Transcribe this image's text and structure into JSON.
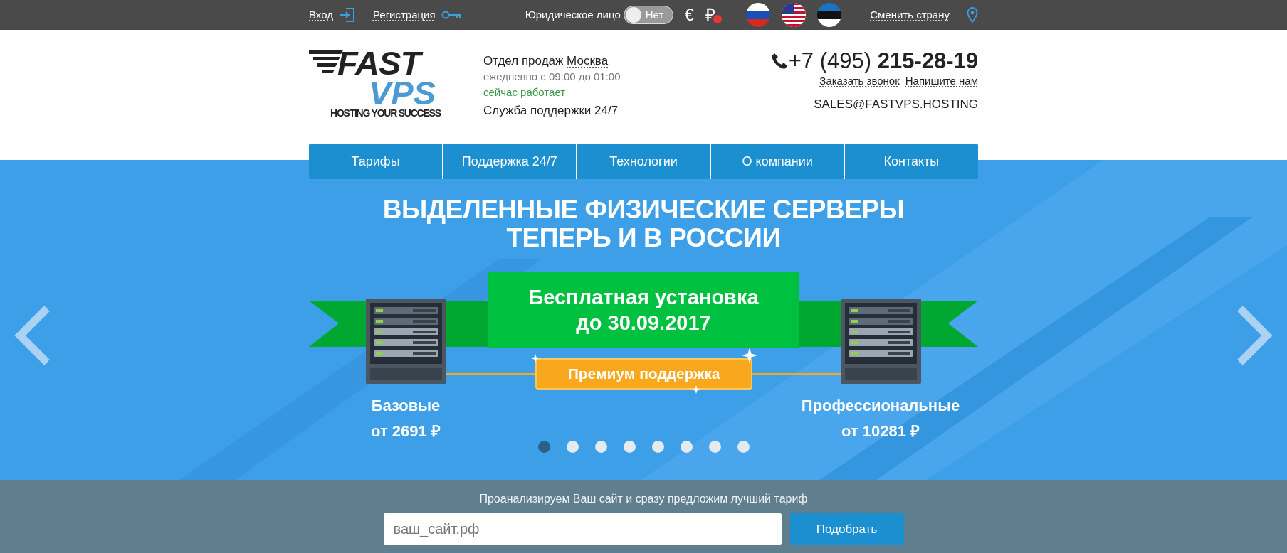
{
  "top_bar": {
    "login": "Вход",
    "register": "Регистрация",
    "legal_entity": {
      "label": "Юридическое лицо",
      "toggle_text": "Нет",
      "on": false
    },
    "currencies": [
      {
        "symbol": "€",
        "alert": false
      },
      {
        "symbol": "₽",
        "alert": true
      }
    ],
    "change_country": "Сменить страну"
  },
  "header": {
    "logo": {
      "line_1": "FAST",
      "line_2": "VPS",
      "tagline": "HOSTING YOUR SUCCESS"
    },
    "sales": {
      "label": "Отдел продаж",
      "city": "Москва",
      "hours": "ежедневно с 09:00 до 01:00",
      "status": "сейчас работает",
      "support": "Служба поддержки 24/7"
    },
    "phone": {
      "prefix": "+7 (495)",
      "number": "215-28-19"
    },
    "links": [
      "Заказать звонок",
      "Напишите нам"
    ],
    "email": "SALES@FASTVPS.HOSTING"
  },
  "nav": [
    {
      "label": "Тарифы"
    },
    {
      "label": "Поддержка 24/7"
    },
    {
      "label": "Технологии"
    },
    {
      "label": "О компании"
    },
    {
      "label": "Контакты"
    }
  ],
  "banner": {
    "title": [
      "ВЫДЕЛЕННЫЕ ФИЗИЧЕСКИЕ СЕРВЕРЫ",
      "ТЕПЕРЬ И В РОССИИ"
    ],
    "promo": [
      "Бесплатная установка",
      "до 30.09.2017"
    ],
    "badge": "Премиум поддержка",
    "tiers": [
      {
        "name": "Базовые",
        "price": "от 2691 ₽"
      },
      {
        "name": "Профессиональные",
        "price": "от 10281 ₽"
      }
    ],
    "dots": [
      {
        "selected": true
      },
      {
        "selected": false
      },
      {
        "selected": false
      },
      {
        "selected": false
      },
      {
        "selected": false
      },
      {
        "selected": false
      },
      {
        "selected": false
      },
      {
        "selected": false
      }
    ]
  },
  "analyze": {
    "text": "Проанализируем Ваш сайт и сразу предложим лучший тариф",
    "placeholder": "ваш_сайт.рф",
    "button": "Подобрать"
  }
}
